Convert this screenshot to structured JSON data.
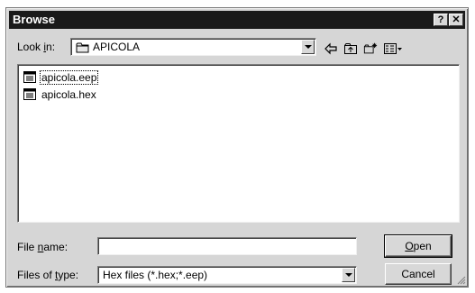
{
  "window": {
    "title": "Browse",
    "help_button": "?",
    "close_button": "✕"
  },
  "lookin": {
    "label_pre": "Look ",
    "label_accel": "i",
    "label_post": "n:",
    "value": "APICOLA",
    "folder_icon": "folder-icon"
  },
  "toolbar": {
    "back_icon": "back-arrow-icon",
    "up_icon": "up-folder-icon",
    "new_folder_icon": "new-folder-icon",
    "view_menu_icon": "view-menu-icon"
  },
  "files": [
    {
      "name": "apicola.eep",
      "icon": "file-icon",
      "focused": true
    },
    {
      "name": "apicola.hex",
      "icon": "file-icon",
      "focused": false
    }
  ],
  "filename": {
    "label_pre": "File ",
    "label_accel": "n",
    "label_post": "ame:",
    "value": ""
  },
  "filetype": {
    "label_pre": "Files of ",
    "label_accel": "t",
    "label_post": "ype:",
    "value": "Hex files (*.hex;*.eep)"
  },
  "buttons": {
    "open_accel": "O",
    "open_rest": "pen",
    "cancel": "Cancel"
  }
}
